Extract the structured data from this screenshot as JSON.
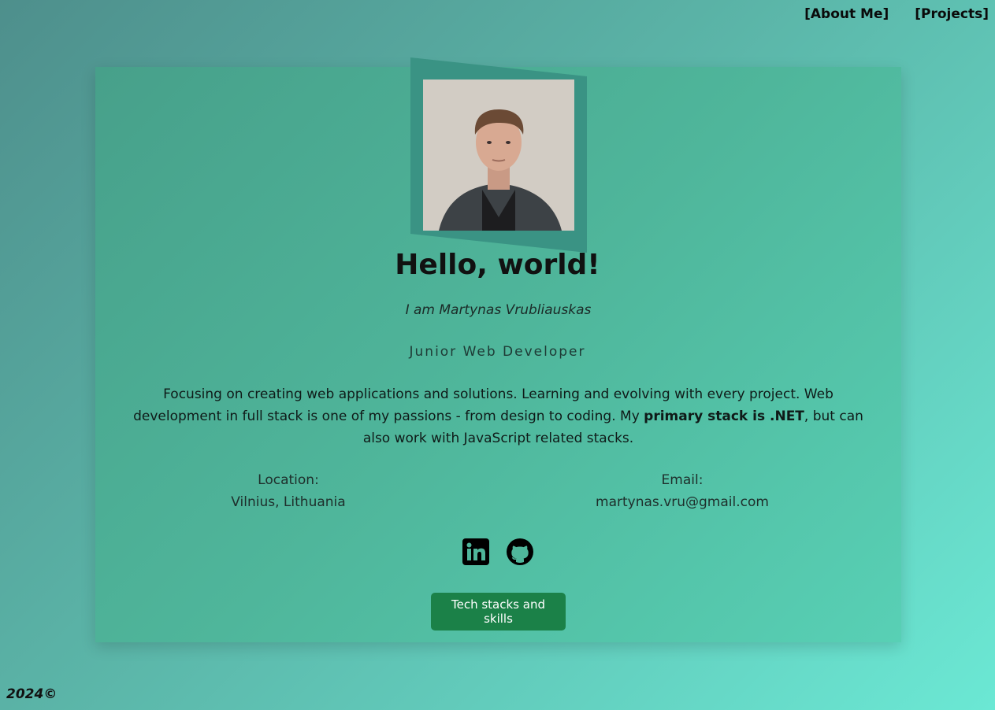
{
  "nav": {
    "about": "[About Me]",
    "projects": "[Projects]"
  },
  "hero": {
    "title": "Hello, world!",
    "subtitle": "I am Martynas Vrubliauskas",
    "role": "Junior Web Developer",
    "description_part1": "Focusing on creating web applications and solutions. Learning and evolving with every project. Web development in full stack is one of my passions - from design to coding. My ",
    "description_bold": "primary stack is .NET",
    "description_part2": ", but can also work with JavaScript related stacks."
  },
  "contact": {
    "location_label": "Location:",
    "location_value": "Vilnius, Lithuania",
    "email_label": "Email:",
    "email_value": "martynas.vru@gmail.com"
  },
  "social": {
    "linkedin_icon": "linkedin-icon",
    "github_icon": "github-icon"
  },
  "cta": {
    "label": "Tech stacks and skills"
  },
  "footer": {
    "text": "2024©"
  },
  "colors": {
    "accent_button": "#1b8148",
    "frame": "#3a9384"
  }
}
